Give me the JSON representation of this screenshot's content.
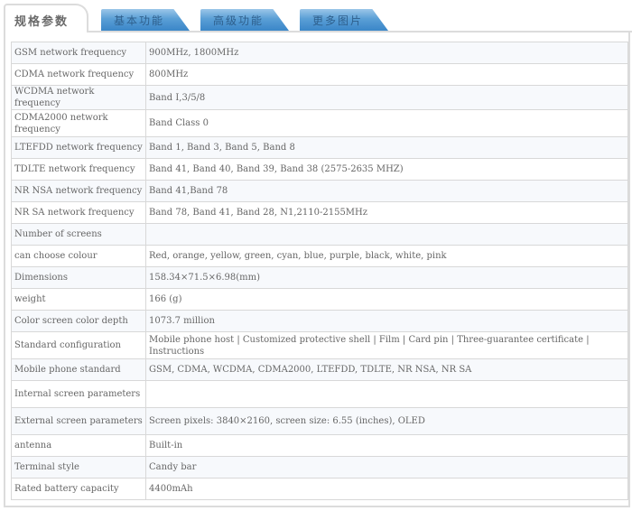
{
  "tabs": {
    "active": "规格参数",
    "others": [
      "基本功能",
      "高级功能",
      "更多图片"
    ]
  },
  "specs": [
    {
      "key": "GSM network frequency",
      "value": "900MHz, 1800MHz"
    },
    {
      "key": "CDMA network frequency",
      "value": "800MHz"
    },
    {
      "key": "WCDMA network frequency",
      "value": "Band I,3/5/8"
    },
    {
      "key": "CDMA2000 network frequency",
      "value": "Band Class 0"
    },
    {
      "key": "LTEFDD network frequency",
      "value": "Band 1, Band 3, Band 5, Band 8"
    },
    {
      "key": "TDLTE network frequency",
      "value": "Band 41, Band 40, Band 39, Band 38 (2575-2635 MHZ)"
    },
    {
      "key": "NR NSA network frequency",
      "value": "Band 41,Band 78"
    },
    {
      "key": "NR SA network frequency",
      "value": "Band 78, Band 41, Band 28, N1,2110-2155MHz"
    },
    {
      "key": "Number of screens",
      "value": ""
    },
    {
      "key": "can choose colour",
      "value": "Red, orange, yellow, green, cyan, blue, purple, black, white, pink"
    },
    {
      "key": "Dimensions",
      "value": "158.34×71.5×6.98(mm)"
    },
    {
      "key": "weight",
      "value": "166 (g)"
    },
    {
      "key": "Color screen color depth",
      "value": "1073.7 million"
    },
    {
      "key": "Standard configuration",
      "value": "Mobile phone host | Customized protective shell | Film | Card pin | Three-guarantee certificate | Instructions"
    },
    {
      "key": "Mobile phone standard",
      "value": "GSM, CDMA, WCDMA, CDMA2000, LTEFDD, TDLTE, NR NSA, NR SA"
    },
    {
      "key": "Internal screen parameters",
      "value": ""
    },
    {
      "key": "External screen parameters",
      "value": "Screen pixels: 3840×2160, screen size: 6.55 (inches), OLED"
    },
    {
      "key": "antenna",
      "value": "Built-in"
    },
    {
      "key": "Terminal style",
      "value": "Candy bar"
    },
    {
      "key": "Rated battery capacity",
      "value": "4400mAh"
    }
  ]
}
